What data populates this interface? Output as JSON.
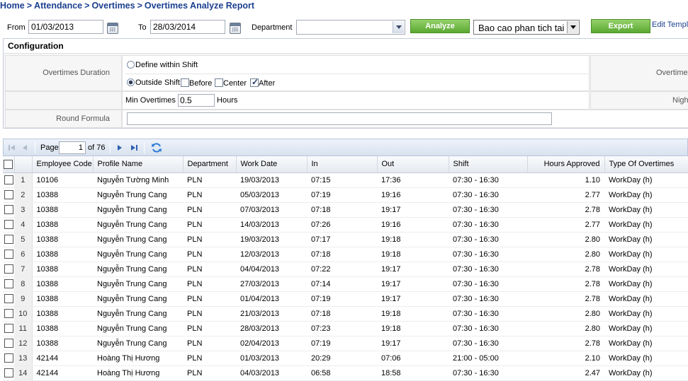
{
  "breadcrumb": [
    "Home",
    "Attendance",
    "Overtimes",
    "Overtimes Analyze Report"
  ],
  "breadcrumb_sep": ">",
  "filters": {
    "from_label": "From",
    "from_value": "01/03/2013",
    "to_label": "To",
    "to_value": "28/03/2014",
    "department_label": "Department",
    "department_value": "",
    "analyze_button": "Analyze",
    "template_value": "Bao cao phan tich tai",
    "export_button": "Export",
    "edit_template_link": "Edit Templ"
  },
  "config": {
    "title": "Configuration",
    "overtimes_duration_label": "Overtimes Duration",
    "define_within_shift": "Define within Shift",
    "outside_shift": "Outside Shift",
    "before": "Before",
    "center": "Center",
    "after": "After",
    "outside_shift_selected": true,
    "before_checked": false,
    "center_checked": false,
    "after_checked": true,
    "min_overtimes_label": "Min Overtimes",
    "min_overtimes_value": "0.5",
    "hours_label": "Hours",
    "round_formula_label": "Round Formula",
    "round_formula_value": "",
    "right_label_1": "Overtimes",
    "right_label_2": "Nigh"
  },
  "pager": {
    "page_label": "Page",
    "page_value": "1",
    "of_label": "of 76"
  },
  "grid": {
    "columns": [
      "Employee Code",
      "Profile Name",
      "Department",
      "Work Date",
      "In",
      "Out",
      "Shift",
      "Hours Approved",
      "Type Of Overtimes"
    ],
    "rows": [
      [
        "1",
        "10106",
        "Nguyễn Tường Minh",
        "PLN",
        "19/03/2013",
        "07:15",
        "17:36",
        "07:30 - 16:30",
        "1.10",
        "WorkDay (h)"
      ],
      [
        "2",
        "10388",
        "Nguyễn Trung Cang",
        "PLN",
        "05/03/2013",
        "07:19",
        "19:16",
        "07:30 - 16:30",
        "2.77",
        "WorkDay (h)"
      ],
      [
        "3",
        "10388",
        "Nguyễn Trung Cang",
        "PLN",
        "07/03/2013",
        "07:18",
        "19:17",
        "07:30 - 16:30",
        "2.78",
        "WorkDay (h)"
      ],
      [
        "4",
        "10388",
        "Nguyễn Trung Cang",
        "PLN",
        "14/03/2013",
        "07:26",
        "19:16",
        "07:30 - 16:30",
        "2.77",
        "WorkDay (h)"
      ],
      [
        "5",
        "10388",
        "Nguyễn Trung Cang",
        "PLN",
        "19/03/2013",
        "07:17",
        "19:18",
        "07:30 - 16:30",
        "2.80",
        "WorkDay (h)"
      ],
      [
        "6",
        "10388",
        "Nguyễn Trung Cang",
        "PLN",
        "12/03/2013",
        "07:18",
        "19:18",
        "07:30 - 16:30",
        "2.80",
        "WorkDay (h)"
      ],
      [
        "7",
        "10388",
        "Nguyễn Trung Cang",
        "PLN",
        "04/04/2013",
        "07:22",
        "19:17",
        "07:30 - 16:30",
        "2.78",
        "WorkDay (h)"
      ],
      [
        "8",
        "10388",
        "Nguyễn Trung Cang",
        "PLN",
        "27/03/2013",
        "07:14",
        "19:17",
        "07:30 - 16:30",
        "2.78",
        "WorkDay (h)"
      ],
      [
        "9",
        "10388",
        "Nguyễn Trung Cang",
        "PLN",
        "01/04/2013",
        "07:19",
        "19:17",
        "07:30 - 16:30",
        "2.78",
        "WorkDay (h)"
      ],
      [
        "10",
        "10388",
        "Nguyễn Trung Cang",
        "PLN",
        "21/03/2013",
        "07:18",
        "19:18",
        "07:30 - 16:30",
        "2.80",
        "WorkDay (h)"
      ],
      [
        "11",
        "10388",
        "Nguyễn Trung Cang",
        "PLN",
        "28/03/2013",
        "07:23",
        "19:18",
        "07:30 - 16:30",
        "2.80",
        "WorkDay (h)"
      ],
      [
        "12",
        "10388",
        "Nguyễn Trung Cang",
        "PLN",
        "02/04/2013",
        "07:19",
        "19:17",
        "07:30 - 16:30",
        "2.78",
        "WorkDay (h)"
      ],
      [
        "13",
        "42144",
        "Hoàng Thị Hương",
        "PLN",
        "01/03/2013",
        "20:29",
        "07:06",
        "21:00 - 05:00",
        "2.10",
        "WorkDay (h)"
      ],
      [
        "14",
        "42144",
        "Hoàng Thị Hương",
        "PLN",
        "04/03/2013",
        "06:58",
        "18:58",
        "07:30 - 16:30",
        "2.47",
        "WorkDay (h)"
      ]
    ]
  },
  "colors": {
    "link": "#1b3f8f",
    "button_green": "#5aa832",
    "pager_bg": "#d8e2ef"
  }
}
